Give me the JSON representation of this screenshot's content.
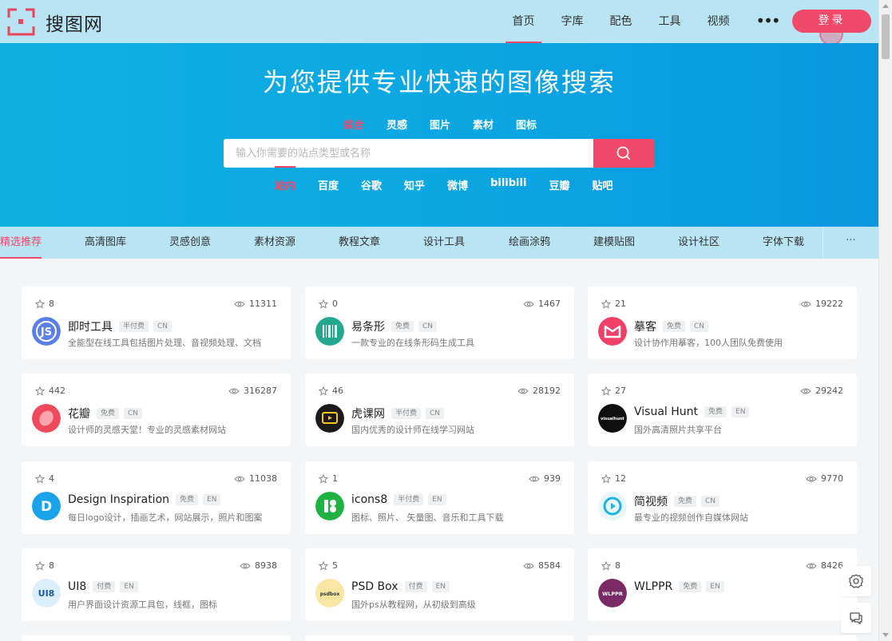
{
  "brand": {
    "name": "搜图网",
    "accent": "#f0496a"
  },
  "nav": {
    "items": [
      "首页",
      "字库",
      "配色",
      "工具",
      "视频"
    ],
    "active_index": 0,
    "more": "•••",
    "login_label": "登录"
  },
  "hero": {
    "title": "为您提供专业快速的图像搜索",
    "search_tabs": [
      "综合",
      "灵感",
      "图片",
      "素材",
      "图标"
    ],
    "search_placeholder": "输入你需要的站点类型或名称",
    "sub_tabs": [
      "站内",
      "百度",
      "谷歌",
      "知乎",
      "微博",
      "bilibili",
      "豆瓣",
      "贴吧"
    ]
  },
  "categories": {
    "items": [
      "精选推荐",
      "高清图库",
      "灵感创意",
      "素材资源",
      "教程文章",
      "设计工具",
      "绘画涂鸦",
      "建模贴图",
      "设计社区",
      "字体下载"
    ],
    "more": "···"
  },
  "cards": [
    {
      "stars": "8",
      "views": "11311",
      "name": "即时工具",
      "tags": [
        "半付费",
        "CN"
      ],
      "desc": "全能型在线工具包括图片处理、音视频处理、文档",
      "icon": "js-icon",
      "icon_bg": "#5b7fe6",
      "icon_text": "JS"
    },
    {
      "stars": "0",
      "views": "1467",
      "name": "易条形",
      "tags": [
        "免费",
        "CN"
      ],
      "desc": "一款专业的在线条形码生成工具",
      "icon": "barcode-icon",
      "icon_bg": "#22a88f",
      "icon_text": ""
    },
    {
      "stars": "21",
      "views": "19222",
      "name": "摹客",
      "tags": [
        "免费",
        "CN"
      ],
      "desc": "设计协作用摹客，100人团队免费使用",
      "icon": "mockplus-icon",
      "icon_bg": "#f0406a",
      "icon_text": ""
    },
    {
      "stars": "442",
      "views": "316287",
      "name": "花瓣",
      "tags": [
        "免费",
        "CN"
      ],
      "desc": "设计师的灵感天堂！专业的灵感素材网站",
      "icon": "petal-icon",
      "icon_bg": "#ee4a5c",
      "icon_text": ""
    },
    {
      "stars": "46",
      "views": "28192",
      "name": "虎课网",
      "tags": [
        "半付费",
        "CN"
      ],
      "desc": "国内优秀的设计师在线学习网站",
      "icon": "tv-icon",
      "icon_bg": "#1a1a1a",
      "icon_text": ""
    },
    {
      "stars": "27",
      "views": "29242",
      "name": "Visual Hunt",
      "tags": [
        "免费",
        "EN"
      ],
      "desc": "国外高清照片共享平台",
      "icon": "visualhunt-icon",
      "icon_bg": "#0f0f0f",
      "icon_text": "visualhunt"
    },
    {
      "stars": "4",
      "views": "11038",
      "name": "Design Inspiration",
      "tags": [
        "免费",
        "EN"
      ],
      "desc": "每日logo设计，插画艺术，网站展示，照片和图案",
      "icon": "d-letter-icon",
      "icon_bg": "#1aa3e8",
      "icon_text": "D"
    },
    {
      "stars": "1",
      "views": "939",
      "name": "icons8",
      "tags": [
        "半付费",
        "EN"
      ],
      "desc": "图标、照片、 矢量图、音乐和工具下载",
      "icon": "icons8-icon",
      "icon_bg": "#1fb141",
      "icon_text": ""
    },
    {
      "stars": "12",
      "views": "9770",
      "name": "简视频",
      "tags": [
        "免费",
        "CN"
      ],
      "desc": "最专业的视频创作自媒体网站",
      "icon": "play-icon",
      "icon_bg": "#e6f6fb",
      "icon_text": ""
    },
    {
      "stars": "8",
      "views": "8938",
      "name": "UI8",
      "tags": [
        "付费",
        "EN"
      ],
      "desc": "用户界面设计资源工具包，线框，图标",
      "icon": "ui8-icon",
      "icon_bg": "#dbeefc",
      "icon_text": "UI8"
    },
    {
      "stars": "5",
      "views": "8584",
      "name": "PSD Box",
      "tags": [
        "付费",
        "EN"
      ],
      "desc": "国外ps从教程网，从初级到高级",
      "icon": "psdbox-icon",
      "icon_bg": "#f9e6a3",
      "icon_text": "psdbox"
    },
    {
      "stars": "8",
      "views": "8426",
      "name": "WLPPR",
      "tags": [
        "免费",
        "EN"
      ],
      "desc": "",
      "icon": "wlppr-icon",
      "icon_bg": "#7a2b66",
      "icon_text": "WLPPR"
    }
  ],
  "float_tools": [
    "settings-icon",
    "feedback-icon"
  ]
}
